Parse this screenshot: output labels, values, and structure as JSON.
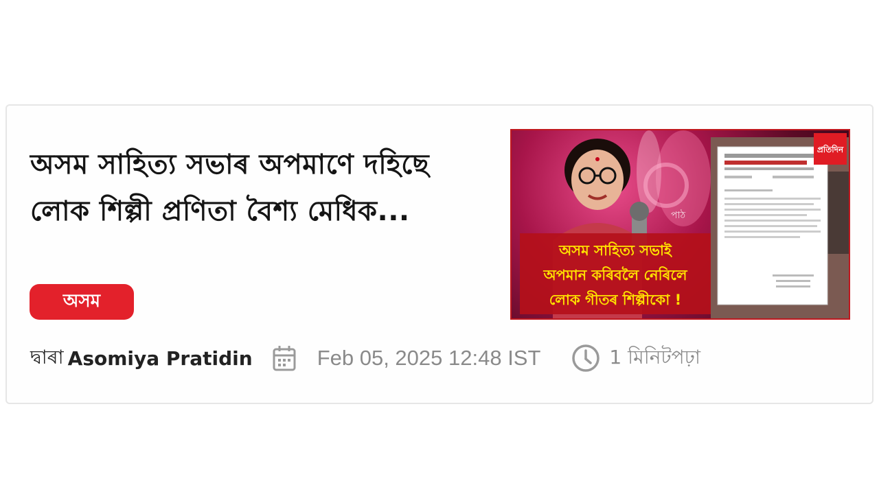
{
  "article": {
    "headline": "অসম সাহিত্য সভাৰ অপমাণে দহিছে লোক শিল্পী প্ৰণিতা বৈশ্য মেধিক...",
    "category": "অসম",
    "byline_prefix": "দ্বাৰা",
    "author": "Asomiya Pratidin",
    "date": "Feb 05, 2025 12:48 IST",
    "read_time": "1 মিনিটপঢ়া"
  },
  "thumbnail": {
    "caption_lines": [
      "অসম সাহিত্য সভাই",
      "অপমান কৰিবলৈ নেৰিলে",
      "লোক গীতৰ শিল্পীকো !"
    ],
    "logo_text": "প্ৰতিদিন",
    "watermark": "পাঠ"
  },
  "colors": {
    "badge": "#e3212b",
    "thumb_border": "#c0181f",
    "caption_text": "#ffe100",
    "caption_bg": "#b4101a"
  }
}
